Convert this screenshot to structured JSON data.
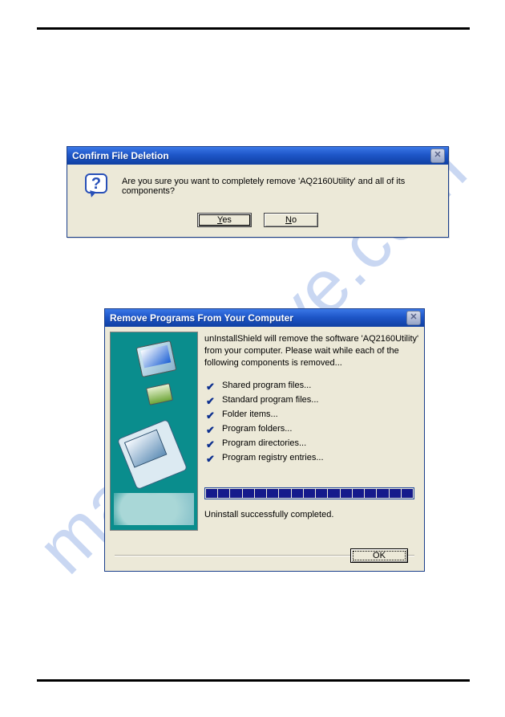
{
  "watermark": "manualsrive.com",
  "dialog1": {
    "title": "Confirm File Deletion",
    "close_glyph": "✕",
    "message": "Are you sure you want to completely remove 'AQ2160Utility' and all of its components?",
    "yes_full": "Yes",
    "yes_letter": "Y",
    "yes_rest": "es",
    "no_full": "No",
    "no_letter": "N",
    "no_rest": "o",
    "question_mark": "?"
  },
  "dialog2": {
    "title": "Remove Programs From Your Computer",
    "close_glyph": "✕",
    "intro": "unInstallShield will remove the software 'AQ2160Utility' from your computer.  Please wait while each of the following components is removed...",
    "items": [
      "Shared program files...",
      "Standard program files...",
      "Folder items...",
      "Program folders...",
      "Program directories...",
      "Program registry entries..."
    ],
    "check_glyph": "✔",
    "done": "Uninstall successfully completed.",
    "ok_label": "OK",
    "progress_segments": 17
  }
}
